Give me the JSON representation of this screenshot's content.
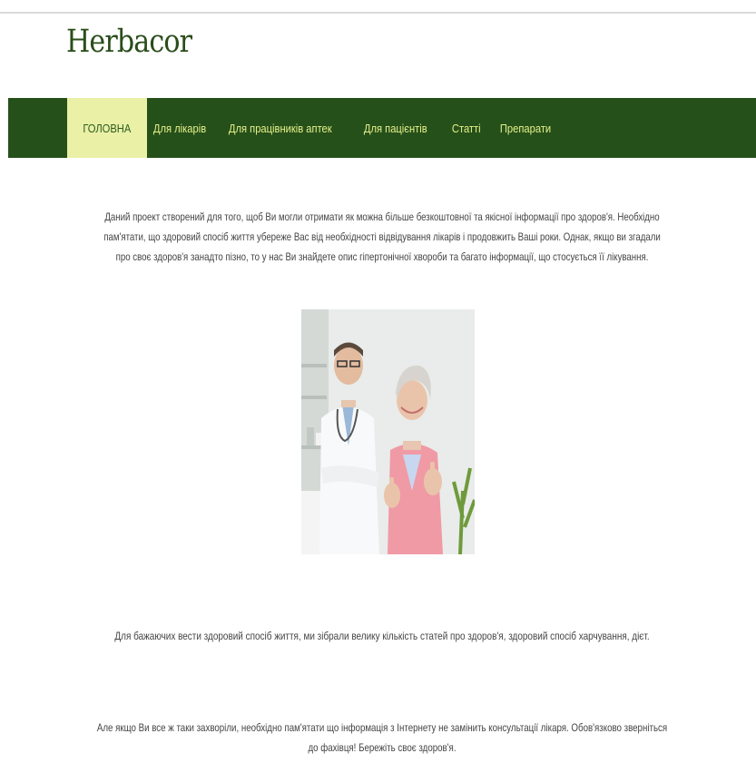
{
  "header": {
    "site_title": "Herbacor"
  },
  "nav": {
    "items": [
      {
        "label": "ГОЛОВНА",
        "active": true
      },
      {
        "label": "Для лікарів",
        "active": false
      },
      {
        "label": "Для працівників аптек",
        "active": false
      },
      {
        "label": "Для пацієнтів",
        "active": false
      },
      {
        "label": "Статті",
        "active": false
      },
      {
        "label": "Препарати",
        "active": false
      }
    ]
  },
  "main": {
    "intro": "Даний проект створений для того, щоб Ви могли отримати як можна більше безкоштовної та якісної інформації про здоров'я. Необхідно пам'ятати, що здоровий спосіб життя убереже Вас від необхідності відвідування лікарів і продовжить Ваші роки. Однак, якщо ви згадали про своє здоров'я занадто пізно, то у нас Ви знайдете опис гіпертонічної хвороби та багато інформації, що стосується її лікування.",
    "articles_note": "Для бажаючих вести здоровий спосіб життя, ми зібрали велику кількість статей про здоров'я, здоровий спосіб харчування, дієт.",
    "warning": "Але якщо Ви все ж таки захворіли, необхідно пам'ятати що інформація з Інтернету не замінить консультації лікаря. Обов'язково зверніться до фахівця! Бережіть своє здоров'я."
  },
  "colors": {
    "nav_background": "#26501a",
    "nav_text": "#e4f08a",
    "nav_active_background": "#eaf0a6",
    "title": "#2a4d1a"
  },
  "icons": {
    "hero_image": "doctor-and-patient-photo"
  }
}
